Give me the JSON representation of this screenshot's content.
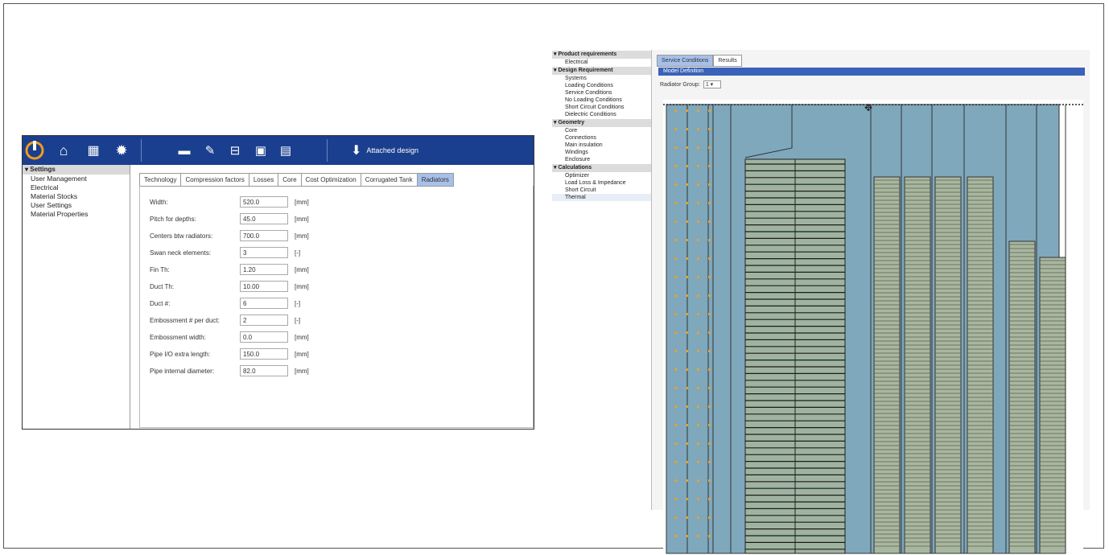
{
  "left_app": {
    "attached_label": "Attached design",
    "nav": {
      "section": "Settings",
      "items": [
        "User Management",
        "Electrical",
        "Material Stocks",
        "User Settings",
        "Material Properties"
      ]
    },
    "tabs": [
      "Technology",
      "Compression factors",
      "Losses",
      "Core",
      "Cost Optimization",
      "Corrugated Tank",
      "Radiators"
    ],
    "selected_tab": "Radiators",
    "fields": [
      {
        "label": "Width:",
        "value": "520.0",
        "unit": "[mm]"
      },
      {
        "label": "Pitch for depths:",
        "value": "45.0",
        "unit": "[mm]"
      },
      {
        "label": "Centers btw radiators:",
        "value": "700.0",
        "unit": "[mm]"
      },
      {
        "label": "Swan neck elements:",
        "value": "3",
        "unit": "[-]"
      },
      {
        "label": "Fin Th:",
        "value": "1.20",
        "unit": "[mm]"
      },
      {
        "label": "Duct Th:",
        "value": "10.00",
        "unit": "[mm]"
      },
      {
        "label": "Duct #:",
        "value": "6",
        "unit": "[-]"
      },
      {
        "label": "Embossment # per duct:",
        "value": "2",
        "unit": "[-]"
      },
      {
        "label": "Embossment width:",
        "value": "0.0",
        "unit": "[mm]"
      },
      {
        "label": "Pipe I/O extra length:",
        "value": "150.0",
        "unit": "[mm]"
      },
      {
        "label": "Pipe internal diameter:",
        "value": "82.0",
        "unit": "[mm]"
      }
    ],
    "colors": {
      "topbar": "#1a3f8f",
      "tab_selected": "#a7c0ea"
    }
  },
  "right_app": {
    "nav": [
      {
        "section": "Product requirements",
        "items": [
          "Electrical"
        ]
      },
      {
        "section": "Design Requirement",
        "items": [
          "Systems",
          "Loading Conditions",
          "Service Conditions",
          "No Loading Conditions",
          "Short Circuit Conditions",
          "Dielectric Conditions"
        ]
      },
      {
        "section": "Geometry",
        "items": [
          "Core",
          "Connections",
          "Main insulation",
          "Windings",
          "Enclosure"
        ]
      },
      {
        "section": "Calculations",
        "items": [
          "Optimizer",
          "Load Loss & Impedance",
          "Short Circuit",
          "Thermal"
        ]
      }
    ],
    "selected_item": "Thermal",
    "tabs": [
      "Service Conditions",
      "Results"
    ],
    "subheader": "Model Definition",
    "radiator_group_label": "Radiator Group:",
    "radiator_group_value": "1",
    "colors": {
      "canvas_fill": "#7fa8bc",
      "header": "#3a62b8"
    }
  }
}
